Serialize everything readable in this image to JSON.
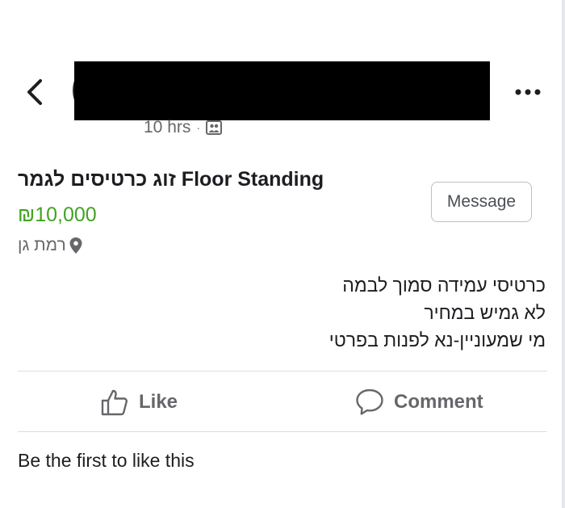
{
  "header": {
    "back_icon": "chevron-left-icon",
    "more_icon": "more-horizontal-icon",
    "time_ago": "10 hrs",
    "separator": "·",
    "audience_icon": "friends-audience-icon"
  },
  "listing": {
    "title": "זוג כרטיסים לגמר Floor Standing",
    "price": "₪10,000",
    "price_color": "#42a321",
    "location": "רמת גן",
    "location_icon": "map-pin-icon",
    "message_button": "Message",
    "description": [
      "כרטיסי עמידה סמוך לבמה",
      "לא גמיש במחיר",
      "מי שמעוניין-נא לפנות בפרטי"
    ]
  },
  "actions": {
    "like_label": "Like",
    "like_icon": "thumbs-up-icon",
    "comment_label": "Comment",
    "comment_icon": "comment-icon"
  },
  "footer": {
    "likes_text": "Be the first to like this"
  }
}
